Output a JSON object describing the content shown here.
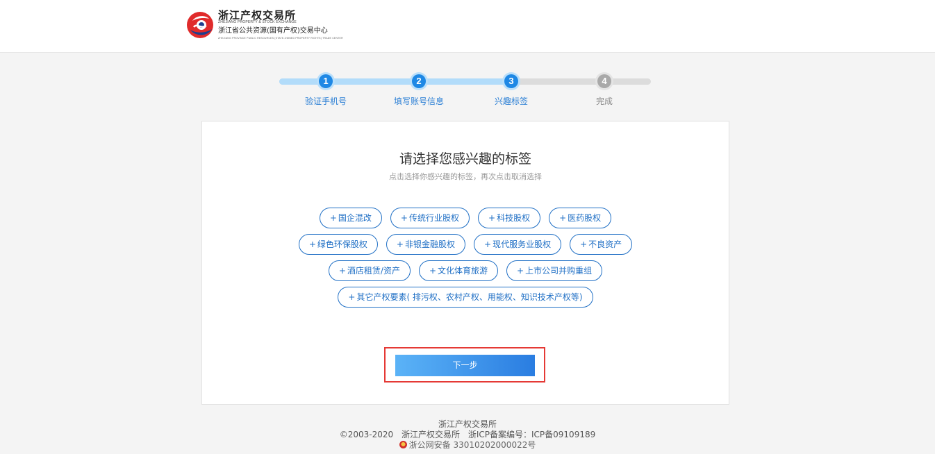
{
  "header": {
    "logo": {
      "name_cn": "浙江产权交易所",
      "name_en": "ZHEJIANG PROPERTY & STOCK EXCHANGE",
      "sub_cn": "浙江省公共资源(国有产权)交易中心",
      "sub_en": "ZHEJIANG PROVINCE PUBLIC RESOURCES (STATE-OWNED PROPERTY RIGHTS) TRADE CENTER"
    }
  },
  "steps": {
    "progress": 0.625,
    "items": [
      {
        "num": "1",
        "label": "验证手机号",
        "state": "done"
      },
      {
        "num": "2",
        "label": "填写账号信息",
        "state": "done"
      },
      {
        "num": "3",
        "label": "兴趣标签",
        "state": "done"
      },
      {
        "num": "4",
        "label": "完成",
        "state": "todo"
      }
    ]
  },
  "panel": {
    "title": "请选择您感兴趣的标签",
    "subtitle": "点击选择你感兴趣的标签，再次点击取消选择",
    "tag_plus": "+",
    "tag_rows": [
      [
        "国企混改",
        "传统行业股权",
        "科技股权",
        "医药股权"
      ],
      [
        "绿色环保股权",
        "非银金融股权",
        "现代服务业股权",
        "不良资产"
      ],
      [
        "酒店租赁/资产",
        "文化体育旅游",
        "上市公司并购重组"
      ],
      [
        "其它产权要素( 排污权、农村产权、用能权、知识技术产权等)"
      ]
    ],
    "next_label": "下一步"
  },
  "footer": {
    "org": "浙江产权交易所",
    "copyright": "©2003-2020",
    "copyright_org": "浙江产权交易所",
    "icp": "浙ICP备案编号：ICP备09109189",
    "police": "浙公网安备 33010202000022号"
  },
  "colors": {
    "accent": "#1e88e5",
    "tag_border": "#1f6fc5",
    "highlight": "#e53935",
    "button_start": "#5bb3f7",
    "button_end": "#2a7de1"
  }
}
